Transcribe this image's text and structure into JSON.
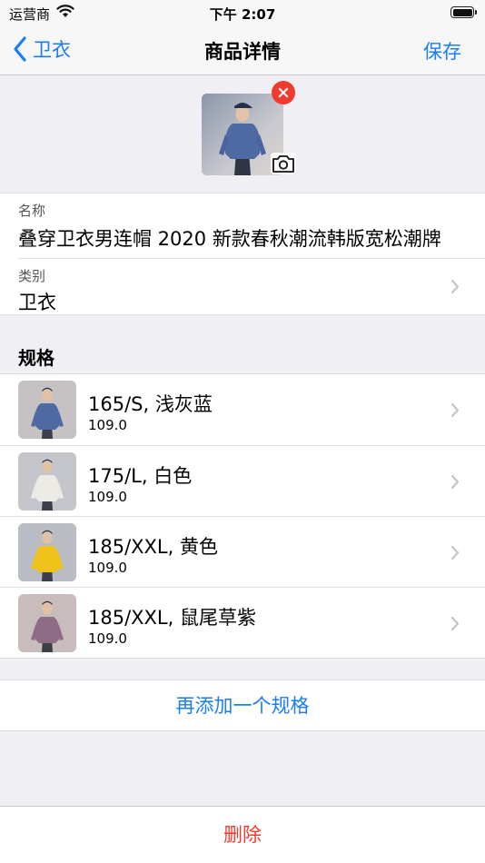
{
  "status_bar": {
    "carrier": "运营商",
    "time": "下午 2:07"
  },
  "nav": {
    "back_label": "卫衣",
    "title": "商品详情",
    "save_label": "保存"
  },
  "product": {
    "name_label": "名称",
    "name_value": "叠穿卫衣男连帽 2020 新款春秋潮流韩版宽松潮牌",
    "category_label": "类别",
    "category_value": "卫衣"
  },
  "specs": {
    "header": "规格",
    "items": [
      {
        "title": "165/S, 浅灰蓝",
        "price": "109.0",
        "hoodie_color": "#4f6aa3",
        "bg": "#c6c2c4"
      },
      {
        "title": "175/L, 白色",
        "price": "109.0",
        "hoodie_color": "#ecebe6",
        "bg": "#c4c6cc"
      },
      {
        "title": "185/XXL, 黄色",
        "price": "109.0",
        "hoodie_color": "#efc21c",
        "bg": "#b9bcc2"
      },
      {
        "title": "185/XXL, 鼠尾草紫",
        "price": "109.0",
        "hoodie_color": "#8f6c86",
        "bg": "#c9bcbc"
      }
    ]
  },
  "actions": {
    "add_spec_label": "再添加一个规格",
    "delete_label": "删除"
  },
  "colors": {
    "accent": "#1a7ef2",
    "destructive": "#f03a2e",
    "background": "#efeff4"
  }
}
